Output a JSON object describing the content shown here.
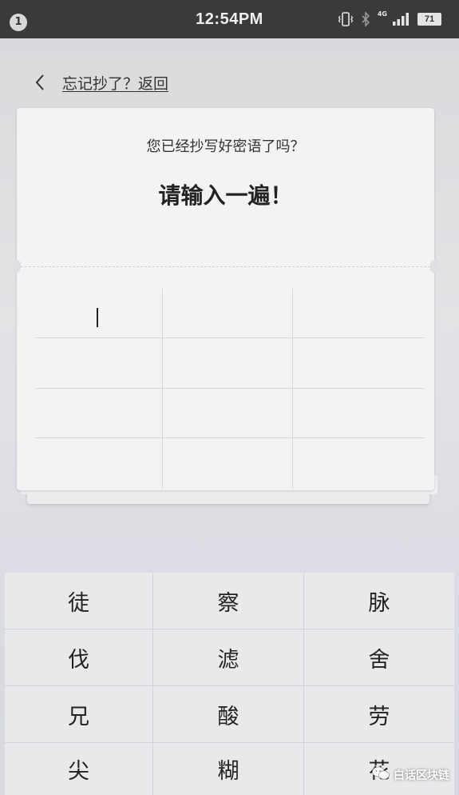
{
  "status_bar": {
    "notification_count": "1",
    "time": "12:54PM",
    "network_type": "4G",
    "battery_level": "71",
    "icons": [
      "vibrate-icon",
      "bluetooth-icon",
      "signal-icon",
      "battery-icon"
    ]
  },
  "header": {
    "back_label": "忘记抄了？返回"
  },
  "card": {
    "question": "您已经抄写好密语了吗？",
    "title": "请输入一遍！",
    "entered_words": [
      "",
      "",
      "",
      "",
      "",
      "",
      "",
      "",
      "",
      "",
      "",
      ""
    ]
  },
  "keyboard": {
    "keys": [
      "徒",
      "察",
      "脉",
      "伐",
      "滤",
      "舍",
      "兄",
      "酸",
      "劳",
      "尖",
      "糊",
      "花"
    ]
  },
  "watermark": {
    "text": "白话区块链"
  },
  "colors": {
    "status_bar": "#3a3a3c",
    "card_background": "#f3f3f2",
    "keyboard_background": "#e9e9ec"
  }
}
